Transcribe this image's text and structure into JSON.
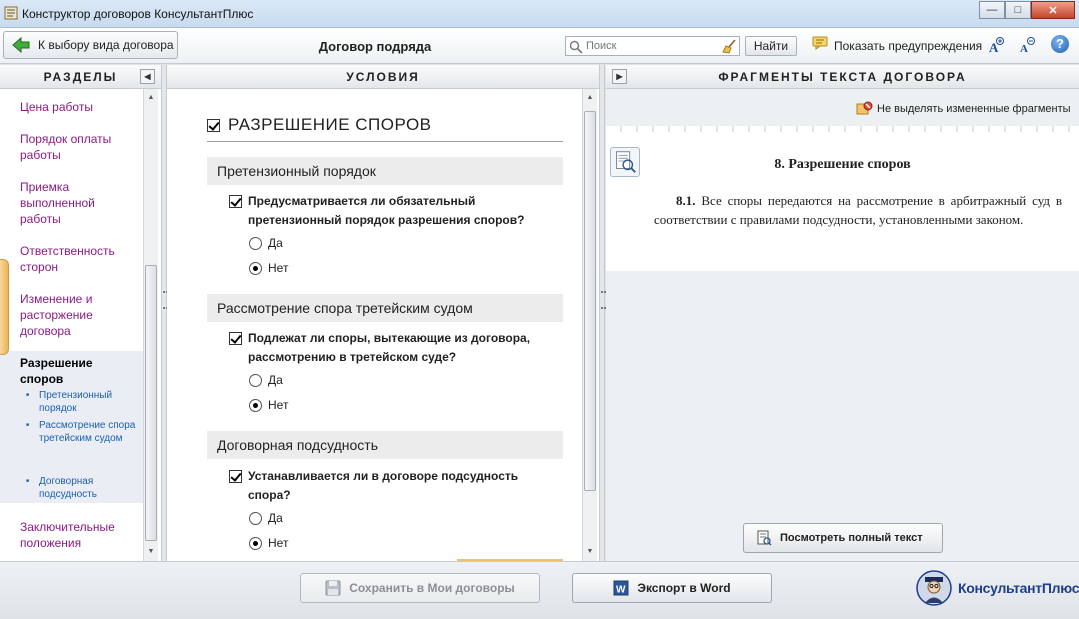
{
  "window": {
    "title": "Конструктор договоров КонсультантПлюс",
    "minimize": "—",
    "maximize": "□",
    "close": "✕"
  },
  "toolbar": {
    "back_label": "К выбору вида договора",
    "doc_title": "Договор подряда",
    "search_placeholder": "Поиск",
    "find_label": "Найти",
    "warnings_label": "Показать предупреждения",
    "font_increase_icon": "font-increase-icon",
    "font_decrease_icon": "font-decrease-icon",
    "help_label": "?"
  },
  "sections_panel": {
    "title": "РАЗДЕЛЫ",
    "items": [
      {
        "label": "Цена работы"
      },
      {
        "label": "Порядок оплаты работы"
      },
      {
        "label": "Приемка выполненной работы"
      },
      {
        "label": "Ответственность сторон"
      },
      {
        "label": "Изменение и расторжение договора"
      },
      {
        "label": "Разрешение споров",
        "active": true
      },
      {
        "label": "Заключительные положения"
      }
    ],
    "subitems": [
      {
        "label": "Претензионный порядок"
      },
      {
        "label": "Рассмотрение спора третейским судом"
      },
      {
        "label": "Договорная подсудность"
      }
    ]
  },
  "conditions_panel": {
    "title": "УСЛОВИЯ",
    "section_title": "РАЗРЕШЕНИЕ СПОРОВ",
    "groups": [
      {
        "title": "Претензионный порядок",
        "question": "Предусматривается ли обязательный претензионный порядок разрешения споров?",
        "options": [
          "Да",
          "Нет"
        ],
        "selected": "Нет"
      },
      {
        "title": "Рассмотрение спора третейским судом",
        "question": "Подлежат ли споры, вытекающие из договора, рассмотрению в третейском суде?",
        "options": [
          "Да",
          "Нет"
        ],
        "selected": "Нет"
      },
      {
        "title": "Договорная подсудность",
        "question": "Устанавливается ли в договоре подсудность спора?",
        "options": [
          "Да",
          "Нет"
        ],
        "selected": "Нет"
      }
    ]
  },
  "fragments_panel": {
    "title": "ФРАГМЕНТЫ ТЕКСТА ДОГОВОРА",
    "highlight_label": "Не выделять измененные фрагменты",
    "heading": "8. Разрешение споров",
    "clause_number": "8.1.",
    "clause_text": "Все споры передаются на рассмотрение в арбитражный суд в соответствии с правилами подсудности, установленными законом.",
    "view_full_label": "Посмотреть полный текст"
  },
  "footer": {
    "save_label": "Сохранить в Мои договоры",
    "export_label": "Экспорт в Word",
    "brand": "КонсультантПлюс"
  },
  "colors": {
    "section_link": "#8b1a85",
    "subitem_link": "#1a5fb4",
    "brand": "#1c3e8c"
  }
}
